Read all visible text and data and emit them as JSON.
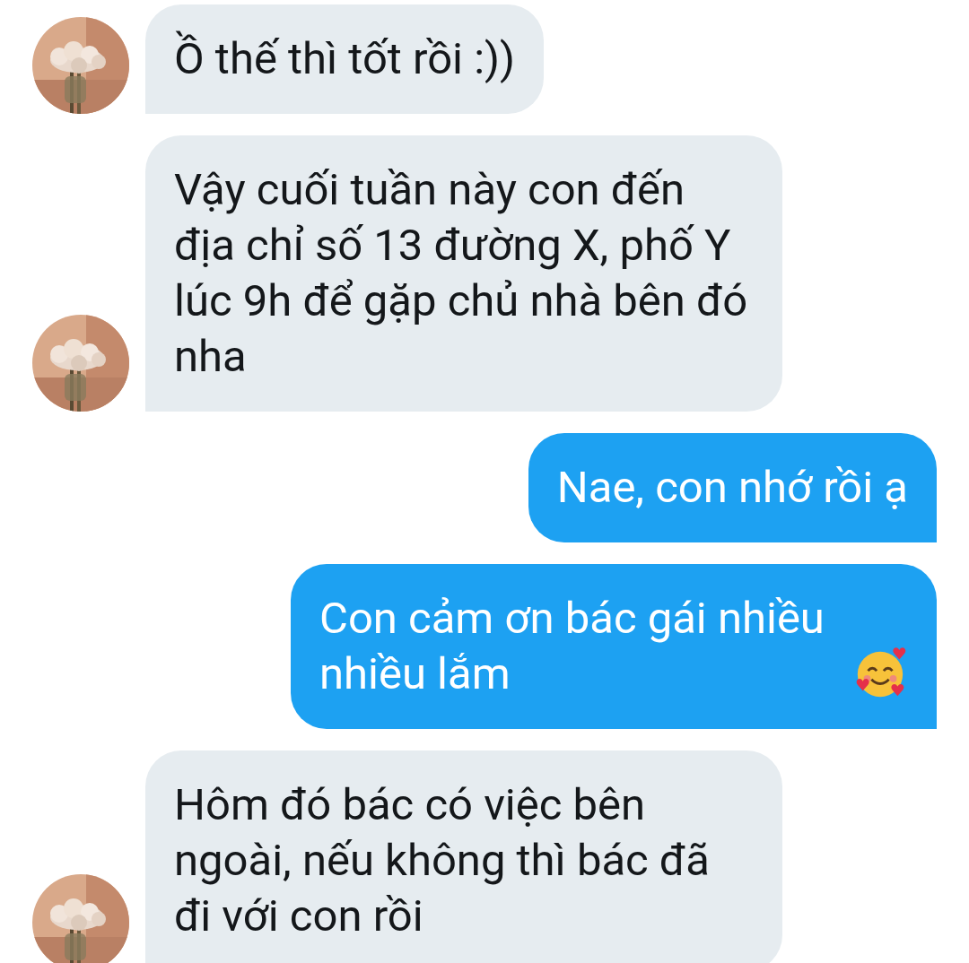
{
  "messages": [
    {
      "kind": "incoming",
      "text": "Ồ thế thì tốt rồi :))",
      "avatar": true
    },
    {
      "kind": "incoming",
      "text": "Vậy cuối tuần này con đến địa chỉ số 13 đường X, phố Y lúc 9h để gặp chủ nhà bên đó nha",
      "avatar": true
    },
    {
      "kind": "outgoing",
      "text": "Nae, con nhớ rồi ạ"
    },
    {
      "kind": "outgoing",
      "text": "Con cảm ơn bác gái nhiều nhiều lắm",
      "emoji": true
    },
    {
      "kind": "incoming",
      "text": "Hôm đó bác có việc bên ngoài, nếu không thì bác đã đi với con rồi",
      "avatar": true
    }
  ]
}
